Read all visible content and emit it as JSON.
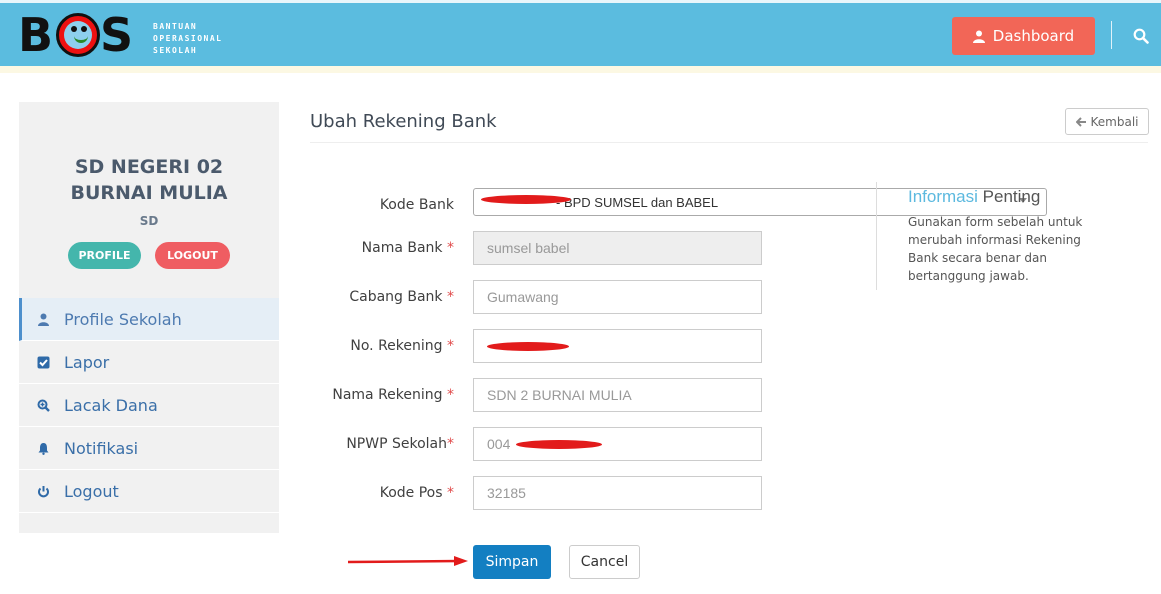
{
  "header": {
    "logo_word_b": "B",
    "logo_word_s": "S",
    "logo_tagline": [
      "BANTUAN",
      "OPERASIONAL",
      "SEKOLAH"
    ],
    "dashboard_label": "Dashboard",
    "search_icon": "search-icon"
  },
  "sidebar": {
    "school_name": "SD NEGERI 02 BURNAI MULIA",
    "school_level": "SD",
    "profile_button": "PROFILE",
    "logout_button": "LOGOUT",
    "items": [
      {
        "label": "Profile Sekolah",
        "icon": "user-icon",
        "active": true
      },
      {
        "label": "Lapor",
        "icon": "check-square-icon",
        "active": false
      },
      {
        "label": "Lacak Dana",
        "icon": "zoom-in-icon",
        "active": false
      },
      {
        "label": "Notifikasi",
        "icon": "bell-icon",
        "active": false
      },
      {
        "label": "Logout",
        "icon": "power-icon",
        "active": false
      }
    ]
  },
  "main": {
    "title": "Ubah Rekening Bank",
    "back_button": "Kembali",
    "form": {
      "kode_bank": {
        "label": "Kode Bank",
        "value": "- BPD SUMSEL dan BABEL"
      },
      "nama_bank": {
        "label": "Nama Bank",
        "required": "*",
        "value": "sumsel babel"
      },
      "cabang_bank": {
        "label": "Cabang Bank",
        "required": "*",
        "value": "Gumawang"
      },
      "no_rekening": {
        "label": "No. Rekening",
        "required": "*",
        "value": ""
      },
      "nama_rekening": {
        "label": "Nama Rekening",
        "required": "*",
        "value": "SDN 2 BURNAI MULIA"
      },
      "npwp": {
        "label": "NPWP Sekolah",
        "required": "*",
        "value": "004"
      },
      "kode_pos": {
        "label": "Kode Pos",
        "required": "*",
        "value": "32185"
      }
    },
    "save_button": "Simpan",
    "cancel_button": "Cancel",
    "info": {
      "title_part1": "Informasi",
      "title_part2": "Penting",
      "text": "Gunakan form sebelah untuk merubah informasi Rekening Bank secara benar dan bertanggung jawab."
    }
  },
  "colors": {
    "header_bg": "#5bbcdf",
    "dashboard_button": "#f26657",
    "save_button": "#137fc2",
    "profile_pill": "#44b6ac",
    "logout_pill": "#ef5d62",
    "annotation_red": "#e21b1b"
  }
}
